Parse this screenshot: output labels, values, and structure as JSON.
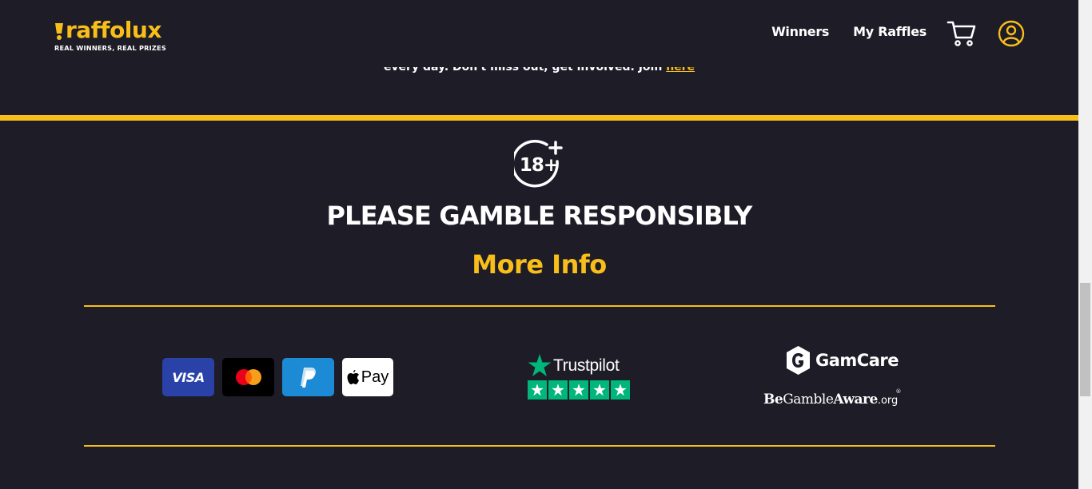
{
  "header": {
    "logo_text": "raffolux",
    "logo_tagline": "REAL WINNERS, REAL PRIZES",
    "nav": [
      {
        "label": "Winners"
      },
      {
        "label": "My Raffles"
      }
    ],
    "cart_icon": "shopping-cart-icon",
    "user_icon": "user-account-icon"
  },
  "promo": {
    "text": "every day. Don't miss out, get involved. Join ",
    "link_text": "here"
  },
  "responsible": {
    "age_badge": "18+",
    "title": "PLEASE GAMBLE RESPONSIBLY",
    "more_info": "More Info"
  },
  "payments": {
    "visa": "VISA",
    "mastercard": "mastercard-icon",
    "paypal": "paypal-icon",
    "apple_pay": "Pay"
  },
  "trustpilot": {
    "label": "Trustpilot",
    "stars": 5
  },
  "gamcare": {
    "label": "GamCare"
  },
  "begambleaware": {
    "be": "Be",
    "gamble": "Gamble",
    "aware": "Aware",
    "org": ".org",
    "reg": "®"
  },
  "colors": {
    "background": "#1d1c27",
    "accent": "#f8be1a",
    "trustpilot_green": "#00b67a",
    "visa_blue": "#2a41a8",
    "paypal_blue": "#1c8ad4"
  }
}
